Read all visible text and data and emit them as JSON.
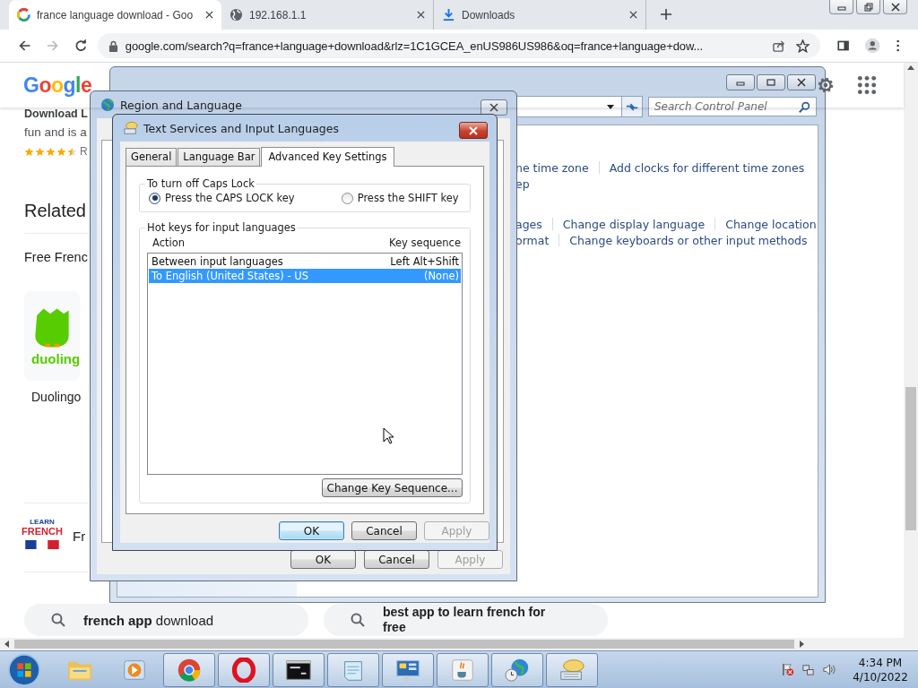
{
  "browser": {
    "tabs": [
      {
        "title": "france language download - Goo",
        "selected": true,
        "kind": "google"
      },
      {
        "title": "192.168.1.1",
        "selected": false,
        "kind": "globe"
      },
      {
        "title": "Downloads",
        "selected": false,
        "kind": "download"
      }
    ],
    "address": "google.com/search?q=france+language+download&rlz=1C1GCEA_enUS986US986&oq=france+language+dow..."
  },
  "google_page": {
    "logo": "Google",
    "snippet_title": "Download L",
    "snippet": "fun and is a",
    "stars": 4.5,
    "rating_label": "R",
    "related_heading": "Related",
    "section_heading": "Free Frenc",
    "app": {
      "logo_text": "duoling",
      "name": "Duolingo"
    },
    "learn_app": {
      "logo_top": "LEARN",
      "logo_bottom": "FRENCH",
      "name": "Fr"
    },
    "suggestions": [
      {
        "text": "**french app** download",
        "bold": false
      },
      {
        "text": "best app to learn french for free",
        "bold": true
      }
    ]
  },
  "control_panel": {
    "search_placeholder": "Search Control Panel",
    "link_rows": [
      [
        "ne time zone",
        "Add clocks for different time zones"
      ],
      [
        "ep"
      ],
      [
        "ages",
        "Change display language",
        "Change location"
      ],
      [
        "ormat",
        "Change keyboards or other input methods"
      ]
    ]
  },
  "region_dialog": {
    "title": "Region and Language",
    "buttons": [
      {
        "label": "OK",
        "disabled": false
      },
      {
        "label": "Cancel",
        "disabled": false
      },
      {
        "label": "Apply",
        "disabled": true
      }
    ]
  },
  "text_services": {
    "title": "Text Services and Input Languages",
    "tabs": [
      {
        "label": "General",
        "selected": false
      },
      {
        "label": "Language Bar",
        "selected": false
      },
      {
        "label": "Advanced Key Settings",
        "selected": true
      }
    ],
    "caps_group": "To turn off Caps Lock",
    "caps_options": [
      {
        "label": "Press the CAPS LOCK key",
        "selected": true
      },
      {
        "label": "Press the SHIFT key",
        "selected": false
      }
    ],
    "hotkeys_group": "Hot keys for input languages",
    "columns": [
      "Action",
      "Key sequence"
    ],
    "rows": [
      {
        "action": "Between input languages",
        "sequence": "Left Alt+Shift",
        "selected": false
      },
      {
        "action": "To English (United States) - US",
        "sequence": "(None)",
        "selected": true
      }
    ],
    "change_button": "Change Key Sequence...",
    "buttons": [
      {
        "label": "OK",
        "disabled": false
      },
      {
        "label": "Cancel",
        "disabled": false
      },
      {
        "label": "Apply",
        "disabled": true
      }
    ]
  },
  "taskbar": {
    "apps": [
      {
        "kind": "folder",
        "open": false
      },
      {
        "kind": "media",
        "open": false
      },
      {
        "kind": "wheel",
        "open": true
      },
      {
        "kind": "ring",
        "open": true
      },
      {
        "kind": "terminal",
        "open": true
      },
      {
        "kind": "notepad",
        "open": true
      },
      {
        "kind": "panel",
        "open": true
      },
      {
        "kind": "cup",
        "open": true
      },
      {
        "kind": "globe",
        "open": true
      },
      {
        "kind": "keyboard",
        "open": true
      }
    ],
    "time": "4:34 PM",
    "date": "4/10/2022"
  }
}
